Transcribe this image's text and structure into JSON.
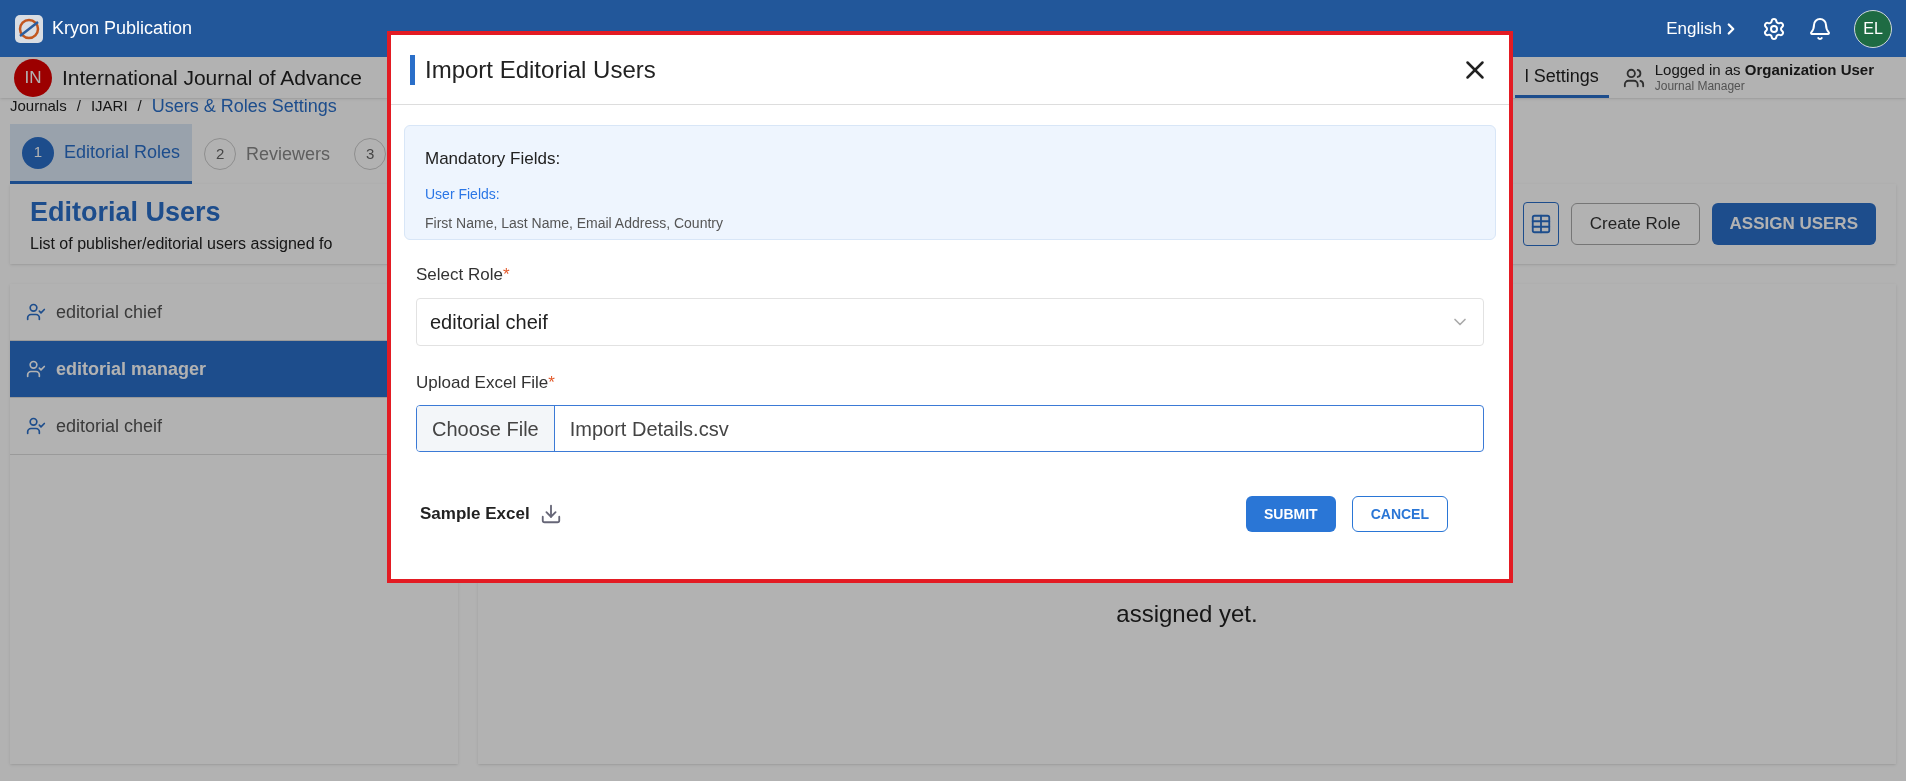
{
  "app": {
    "title": "Kryon Publication",
    "language": "English",
    "avatar": "EL"
  },
  "journal_bar": {
    "badge": "IN",
    "name": "International Journal of Advance",
    "tab": {
      "label": "l Settings",
      "selected": true
    },
    "login": {
      "prefix": "Logged in as",
      "role": "Organization User",
      "subtitle": "Journal Manager"
    }
  },
  "breadcrumb": {
    "separator": "/",
    "items": [
      {
        "label": "Journals",
        "current": false
      },
      {
        "label": "IJARI",
        "current": false
      },
      {
        "label": "Users & Roles Settings",
        "current": true
      }
    ]
  },
  "tabs": [
    {
      "number": "1",
      "label": "Editorial Roles",
      "selected": true
    },
    {
      "number": "2",
      "label": "Reviewers",
      "selected": false
    },
    {
      "number": "3",
      "selected": false
    }
  ],
  "card": {
    "title": "Editorial Users",
    "subtitle": "List of publisher/editorial users assigned fo",
    "buttons": [
      {
        "label": "Create Role",
        "kind": "outline"
      },
      {
        "label": "ASSIGN USERS",
        "kind": "primary"
      }
    ]
  },
  "roles": [
    {
      "label": "editorial chief",
      "selected": false
    },
    {
      "label": "editorial manager",
      "selected": true
    },
    {
      "label": "editorial cheif",
      "selected": false
    }
  ],
  "empty_message": "assigned yet.",
  "modal": {
    "title": "Import Editorial Users",
    "info": {
      "heading": "Mandatory Fields:",
      "group": "User Fields:",
      "fields": "First Name, Last Name, Email Address, Country"
    },
    "required_mark": "*",
    "role_field": {
      "label": "Select Role",
      "required": true,
      "value": "editorial cheif"
    },
    "file_field": {
      "label": "Upload Excel File",
      "required": true,
      "button": "Choose File",
      "value": "Import Details.csv"
    },
    "sample": "Sample Excel",
    "buttons": [
      {
        "label": "SUBMIT",
        "kind": "primary"
      },
      {
        "label": "CANCEL",
        "kind": "outline"
      }
    ]
  }
}
